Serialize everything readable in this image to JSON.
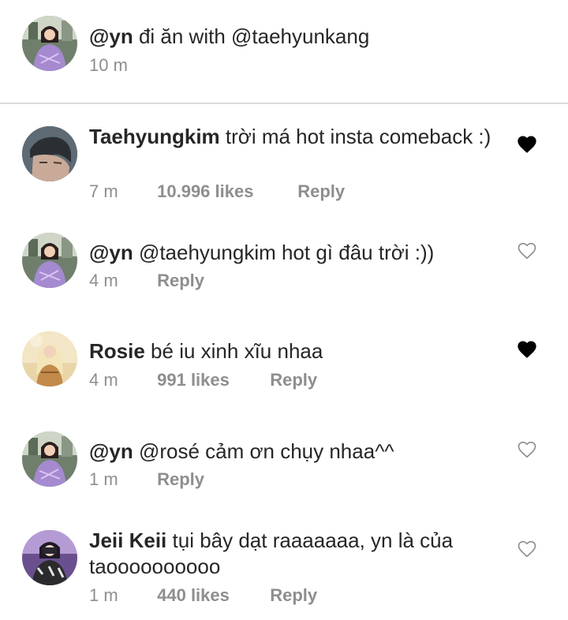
{
  "caption": {
    "username": "@yn",
    "text": "đi ăn with @taehyunkang",
    "time": "10 m"
  },
  "comments": [
    {
      "username": "Taehyungkim",
      "text": "trời má hot insta comeback :)",
      "time": "7 m",
      "likes": "10.996 likes",
      "reply": "Reply",
      "liked": true
    },
    {
      "username": "@yn",
      "text": "@taehyungkim hot gì đâu trời :))",
      "time": "4 m",
      "likes": "",
      "reply": "Reply",
      "liked": false
    },
    {
      "username": "Rosie",
      "text": "bé iu xinh xĩu nhaa",
      "time": "4 m",
      "likes": "991 likes",
      "reply": "Reply",
      "liked": true
    },
    {
      "username": "@yn",
      "text": "@rosé cảm ơn chụy nhaa^^",
      "time": "1 m",
      "likes": "",
      "reply": "Reply",
      "liked": false
    },
    {
      "username": "Jeii Keii",
      "text": "tụi bây dạt raaaaaaa, yn là của taoooooooooo",
      "time": "1 m",
      "likes": "440 likes",
      "reply": "Reply",
      "liked": false
    }
  ],
  "icons": {
    "heart_filled": "heart-filled-icon",
    "heart_outline": "heart-outline-icon"
  },
  "colors": {
    "text": "#262626",
    "secondary": "#8e8e8e",
    "divider": "#dbdbdb",
    "heart_filled": "#000000",
    "heart_outline": "#8e8e8e"
  }
}
